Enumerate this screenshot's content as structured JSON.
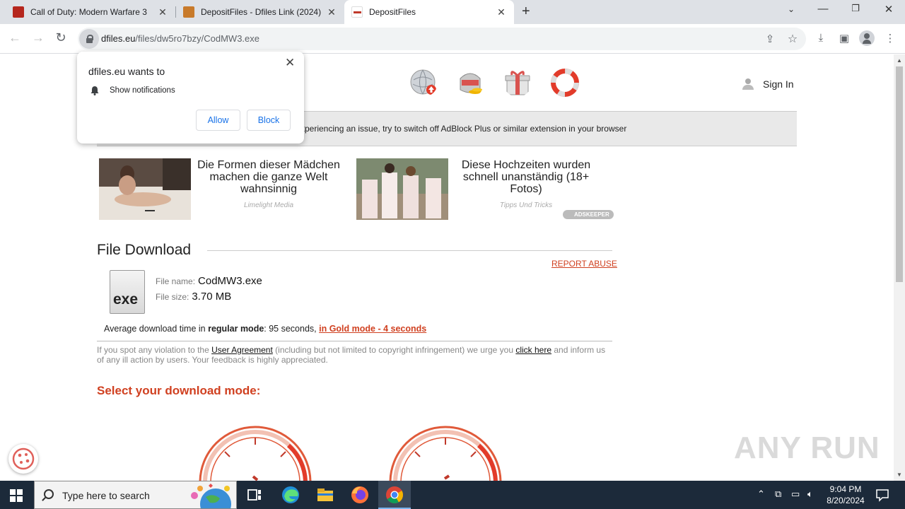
{
  "browser": {
    "tabs": [
      {
        "title": "Call of Duty: Modern Warfare 3",
        "favicon_color": "#b5261d",
        "active": false
      },
      {
        "title": "DepositFiles - Dfiles Link (2024) d",
        "favicon_color": "#c87a2a",
        "active": false
      },
      {
        "title": "DepositFiles",
        "favicon_color": "#c0392b",
        "active": true
      }
    ],
    "url_host": "dfiles.eu",
    "url_path": "/files/dw5ro7bzy/CodMW3.exe"
  },
  "notification_popup": {
    "title": "dfiles.eu wants to",
    "permission": "Show notifications",
    "allow_label": "Allow",
    "block_label": "Block"
  },
  "page": {
    "signin_label": "Sign In",
    "notice_text": "xperiencing an issue, try to switch off AdBlock Plus or similar extension in your browser",
    "ads": [
      {
        "title": "Die Formen dieser Mädchen machen die ganze Welt wahnsinnig",
        "source": "Limelight Media"
      },
      {
        "title": "Diese Hochzeiten wurden schnell unanständig (18+ Fotos)",
        "source": "Tipps Und Tricks"
      }
    ],
    "adskeeper_label": "ADSKEEPER",
    "section_title": "File Download",
    "report_abuse": "REPORT ABUSE",
    "file_ext": "exe",
    "file_name_label": "File name:",
    "file_name": "CodMW3.exe",
    "file_size_label": "File size:",
    "file_size": "3.70 MB",
    "avg_prefix": "Average download time in ",
    "avg_regular_label": "regular mode",
    "avg_regular_value": ": 95 seconds, ",
    "avg_gold": "in Gold mode - 4 seconds",
    "violation_1": "If you spot any violation to the ",
    "violation_link1": "User Agreement",
    "violation_2": " (including but not limited to copyright infringement) we urge you ",
    "violation_link2": "click here",
    "violation_3": " and inform us of any ill action by users. Your feedback is highly appreciated.",
    "select_mode": "Select your download mode:"
  },
  "watermark": "ANY RUN",
  "taskbar": {
    "search_placeholder": "Type here to search",
    "time": "9:04 PM",
    "date": "8/20/2024"
  },
  "colors": {
    "accent_red": "#d04020",
    "link_blue": "#1a73e8",
    "taskbar_bg": "#1c2a3a"
  }
}
